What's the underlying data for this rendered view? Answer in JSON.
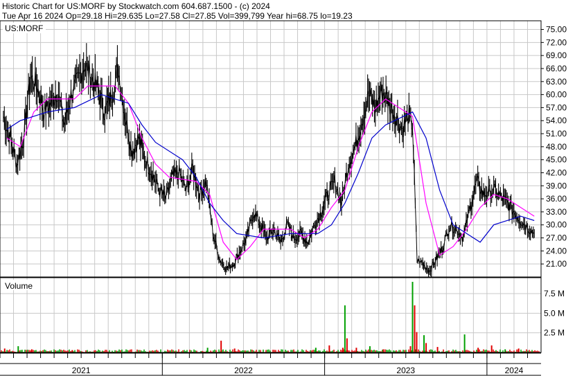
{
  "header": {
    "line1": "Historic Chart for US:MORF by Stockwatch.com 604.687.1500 - (c) 2024",
    "line2": "Tue Apr 16 2024   Op=29.18  Hi=29.635  Lo=27.58  Cl=27.85  Vol=399,799   Year hi=68.75   lo=19.23"
  },
  "chart_data": [
    {
      "type": "line",
      "title": "US:MORF",
      "ylim": [
        18,
        77
      ],
      "y_ticks": [
        "75.00",
        "72.00",
        "69.00",
        "66.00",
        "63.00",
        "60.00",
        "57.00",
        "54.00",
        "51.00",
        "48.00",
        "45.00",
        "42.00",
        "39.00",
        "36.00",
        "33.00",
        "30.00",
        "27.00",
        "24.00",
        "21.00"
      ],
      "x_ticks": [
        "2021",
        "2022",
        "2023",
        "2024"
      ],
      "x_range": [
        "2021-01",
        "2024-04"
      ],
      "grid": true,
      "colors": {
        "price": "#000000",
        "ma_short": "#ff00ff",
        "ma_long": "#0000cc"
      },
      "price_knots": [
        [
          "2021-01",
          55
        ],
        [
          "2021-01",
          50
        ],
        [
          "2021-02",
          44
        ],
        [
          "2021-02",
          50
        ],
        [
          "2021-03",
          64
        ],
        [
          "2021-03",
          62
        ],
        [
          "2021-04",
          56
        ],
        [
          "2021-04",
          58
        ],
        [
          "2021-05",
          61
        ],
        [
          "2021-05",
          53
        ],
        [
          "2021-06",
          60
        ],
        [
          "2021-06",
          63
        ],
        [
          "2021-07",
          67
        ],
        [
          "2021-07",
          64
        ],
        [
          "2021-08",
          61
        ],
        [
          "2021-08",
          56
        ],
        [
          "2021-09",
          60
        ],
        [
          "2021-09",
          66
        ],
        [
          "2021-10",
          55
        ],
        [
          "2021-10",
          47
        ],
        [
          "2021-11",
          50
        ],
        [
          "2021-11",
          45
        ],
        [
          "2021-12",
          42
        ],
        [
          "2021-12",
          38
        ],
        [
          "2022-01",
          36
        ],
        [
          "2022-01",
          41
        ],
        [
          "2022-02",
          42
        ],
        [
          "2022-02",
          38
        ],
        [
          "2022-03",
          43
        ],
        [
          "2022-03",
          37
        ],
        [
          "2022-04",
          40
        ],
        [
          "2022-04",
          28
        ],
        [
          "2022-05",
          22
        ],
        [
          "2022-05",
          20
        ],
        [
          "2022-06",
          21
        ],
        [
          "2022-06",
          24
        ],
        [
          "2022-07",
          27
        ],
        [
          "2022-07",
          33
        ],
        [
          "2022-08",
          30
        ],
        [
          "2022-08",
          27
        ],
        [
          "2022-09",
          29
        ],
        [
          "2022-09",
          26
        ],
        [
          "2022-10",
          30
        ],
        [
          "2022-10",
          27
        ],
        [
          "2022-11",
          28
        ],
        [
          "2022-11",
          26
        ],
        [
          "2022-12",
          30
        ],
        [
          "2022-12",
          33
        ],
        [
          "2023-01",
          37
        ],
        [
          "2023-01",
          40
        ],
        [
          "2023-02",
          35
        ],
        [
          "2023-02",
          44
        ],
        [
          "2023-03",
          48
        ],
        [
          "2023-03",
          54
        ],
        [
          "2023-04",
          60
        ],
        [
          "2023-04",
          57
        ],
        [
          "2023-05",
          61
        ],
        [
          "2023-05",
          58
        ],
        [
          "2023-06",
          55
        ],
        [
          "2023-06",
          52
        ],
        [
          "2023-07",
          55
        ],
        [
          "2023-07",
          53
        ],
        [
          "2023-07",
          22
        ],
        [
          "2023-08",
          21
        ],
        [
          "2023-08",
          19.5
        ],
        [
          "2023-09",
          22
        ],
        [
          "2023-09",
          25
        ],
        [
          "2023-10",
          30
        ],
        [
          "2023-10",
          29
        ],
        [
          "2023-11",
          27
        ],
        [
          "2023-11",
          34
        ],
        [
          "2023-12",
          40
        ],
        [
          "2023-12",
          37
        ],
        [
          "2024-01",
          38
        ],
        [
          "2024-02",
          35
        ],
        [
          "2024-03",
          31
        ],
        [
          "2024-04",
          28
        ]
      ],
      "ma_short": [
        [
          "2021-01",
          50
        ],
        [
          "2021-02",
          48
        ],
        [
          "2021-03",
          56
        ],
        [
          "2021-04",
          59
        ],
        [
          "2021-06",
          59
        ],
        [
          "2021-07",
          62
        ],
        [
          "2021-09",
          62
        ],
        [
          "2021-10",
          58
        ],
        [
          "2021-11",
          50
        ],
        [
          "2021-12",
          44
        ],
        [
          "2022-01",
          41
        ],
        [
          "2022-03",
          40
        ],
        [
          "2022-04",
          37
        ],
        [
          "2022-05",
          26
        ],
        [
          "2022-06",
          22
        ],
        [
          "2022-07",
          25
        ],
        [
          "2022-08",
          29
        ],
        [
          "2022-10",
          29
        ],
        [
          "2022-11",
          27
        ],
        [
          "2022-12",
          29
        ],
        [
          "2023-01",
          34
        ],
        [
          "2023-02",
          38
        ],
        [
          "2023-03",
          48
        ],
        [
          "2023-04",
          56
        ],
        [
          "2023-05",
          59
        ],
        [
          "2023-06",
          57
        ],
        [
          "2023-07",
          55
        ],
        [
          "2023-08",
          35
        ],
        [
          "2023-09",
          23
        ],
        [
          "2023-10",
          25
        ],
        [
          "2023-11",
          29
        ],
        [
          "2023-12",
          34
        ],
        [
          "2024-01",
          37
        ],
        [
          "2024-02",
          36
        ],
        [
          "2024-04",
          32
        ]
      ],
      "ma_long": [
        [
          "2021-01",
          52
        ],
        [
          "2021-02",
          54
        ],
        [
          "2021-04",
          56
        ],
        [
          "2021-06",
          57
        ],
        [
          "2021-08",
          60
        ],
        [
          "2021-10",
          58
        ],
        [
          "2021-11",
          53
        ],
        [
          "2021-12",
          49
        ],
        [
          "2022-02",
          45
        ],
        [
          "2022-03",
          41
        ],
        [
          "2022-04",
          35
        ],
        [
          "2022-05",
          31
        ],
        [
          "2022-06",
          28
        ],
        [
          "2022-08",
          27
        ],
        [
          "2022-10",
          28
        ],
        [
          "2022-12",
          28
        ],
        [
          "2023-01",
          30
        ],
        [
          "2023-02",
          35
        ],
        [
          "2023-03",
          42
        ],
        [
          "2023-04",
          50
        ],
        [
          "2023-05",
          53
        ],
        [
          "2023-07",
          56
        ],
        [
          "2023-08",
          50
        ],
        [
          "2023-09",
          38
        ],
        [
          "2023-10",
          30
        ],
        [
          "2023-11",
          28
        ],
        [
          "2023-12",
          26
        ],
        [
          "2024-01",
          30
        ],
        [
          "2024-03",
          32
        ],
        [
          "2024-04",
          31
        ]
      ]
    },
    {
      "type": "bar",
      "title": "Volume",
      "ylim": [
        0,
        9
      ],
      "y_ticks": [
        "7.5 M",
        "5.0 M",
        "2.5 M"
      ],
      "y_unit": "M",
      "spikes": [
        [
          "2021-01",
          0.5
        ],
        [
          "2021-02",
          0.8
        ],
        [
          "2021-03",
          0.4
        ],
        [
          "2021-06",
          0.3
        ],
        [
          "2022-04",
          0.6
        ],
        [
          "2022-05",
          1.5
        ],
        [
          "2022-06",
          0.5
        ],
        [
          "2022-12",
          0.6
        ],
        [
          "2023-01",
          0.9
        ],
        [
          "2023-02",
          0.6
        ],
        [
          "2023-02",
          6.0
        ],
        [
          "2023-02",
          1.8
        ],
        [
          "2023-03",
          0.6
        ],
        [
          "2023-04",
          0.8
        ],
        [
          "2023-05",
          0.4
        ],
        [
          "2023-07",
          0.8
        ],
        [
          "2023-07",
          9.0
        ],
        [
          "2023-07",
          6.0
        ],
        [
          "2023-07",
          2.6
        ],
        [
          "2023-08",
          2.2
        ],
        [
          "2023-08",
          1.2
        ],
        [
          "2023-09",
          0.7
        ],
        [
          "2023-11",
          2.3
        ],
        [
          "2023-12",
          0.6
        ],
        [
          "2024-01",
          0.9
        ],
        [
          "2024-02",
          0.4
        ],
        [
          "2024-03",
          0.5
        ]
      ]
    }
  ]
}
